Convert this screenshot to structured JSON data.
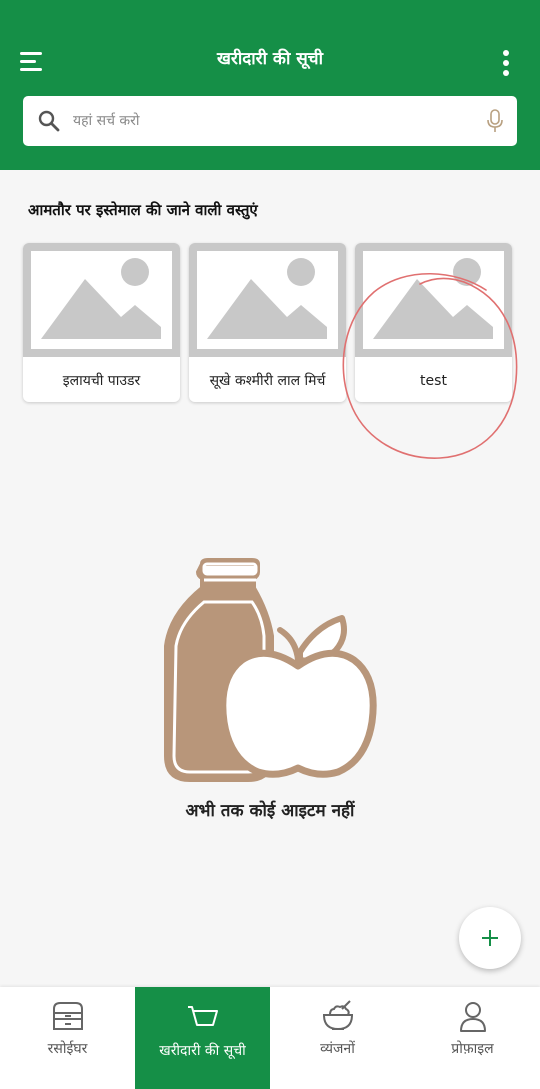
{
  "header": {
    "title": "खरीदारी की सूची",
    "background_color": "#158f47"
  },
  "search": {
    "placeholder": "यहां सर्च करो"
  },
  "section": {
    "title": "आमतौर पर इस्तेमाल की जाने वाली वस्तुएं",
    "items": [
      {
        "label": "इलायची पाउडर",
        "icon": "image-placeholder-icon"
      },
      {
        "label": "सूखे कश्मीरी लाल मिर्च",
        "icon": "image-placeholder-icon"
      },
      {
        "label": "test",
        "icon": "image-placeholder-icon"
      }
    ]
  },
  "empty_state": {
    "message": "अभी तक कोई आइटम नहीं",
    "icon": "bottle-and-apple-illustration"
  },
  "fab": {
    "icon": "plus-icon"
  },
  "bottom_nav": {
    "items": [
      {
        "label": "रसोईघर",
        "icon": "pantry-icon",
        "active": false
      },
      {
        "label": "खरीदारी की सूची",
        "icon": "cart-icon",
        "active": true
      },
      {
        "label": "व्यंजनों",
        "icon": "bowl-icon",
        "active": false
      },
      {
        "label": "प्रोफ़ाइल",
        "icon": "profile-icon",
        "active": false
      }
    ]
  },
  "colors": {
    "accent": "#158f47",
    "illustration": "#b8967a",
    "annotation": "#e07070"
  }
}
